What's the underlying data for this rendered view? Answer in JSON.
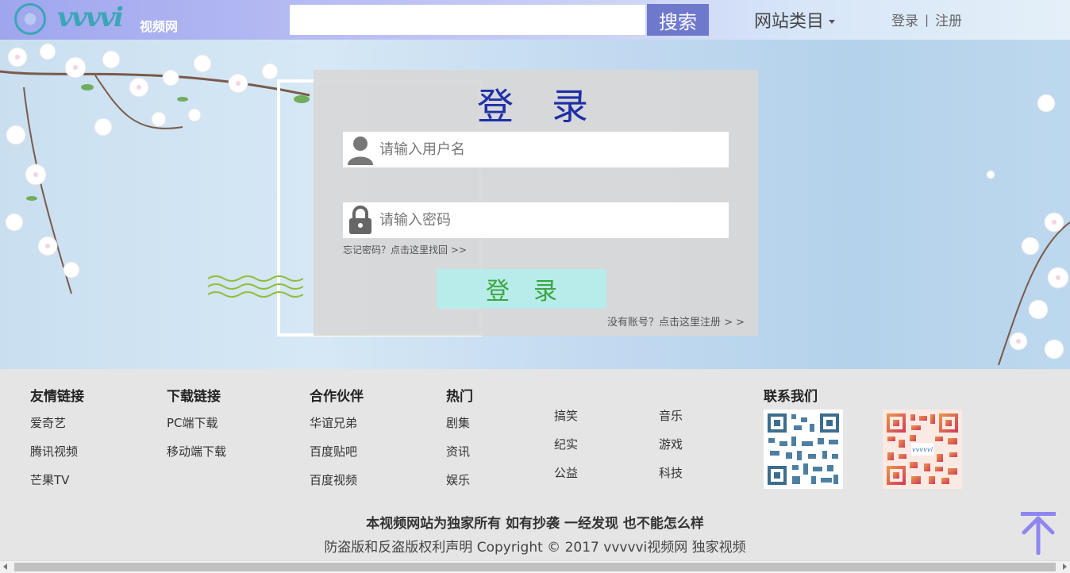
{
  "header": {
    "logo_text": "vvvvi",
    "logo_sub": "视频网",
    "search_placeholder": "",
    "search_button": "搜索",
    "category_label": "网站类目",
    "login_link": "登录",
    "separator": "|",
    "register_link": "注册"
  },
  "login": {
    "title": "登录",
    "username_placeholder": "请输入用户名",
    "password_placeholder": "请输入密码",
    "forgot": "忘记密码？点击这里找回 >>",
    "submit": "登录",
    "register": "没有账号？点击这里注册 > >"
  },
  "footer": {
    "friend_links": {
      "title": "友情链接",
      "items": [
        "爱奇艺",
        "腾讯视频",
        "芒果TV"
      ]
    },
    "downloads": {
      "title": "下载链接",
      "items": [
        "PC端下载",
        "移动端下载"
      ]
    },
    "partners": {
      "title": "合作伙伴",
      "items": [
        "华谊兄弟",
        "百度贴吧",
        "百度视频"
      ]
    },
    "hot": {
      "title": "热门",
      "items": [
        "剧集",
        "资讯",
        "娱乐"
      ]
    },
    "more_a": [
      "搞笑",
      "纪实",
      "公益"
    ],
    "more_b": [
      "音乐",
      "游戏",
      "科技"
    ],
    "contact": {
      "title": "联系我们"
    },
    "qr2_label": "vvvvvi",
    "copyright_1": "本视频网站为独家所有 如有抄袭 一经发现 也不能怎么样",
    "copyright_2": "防盗版和反盗版权利声明 Copyright © 2017 vvvvvi视频网 独家视频"
  },
  "colors": {
    "search_button": "#6f79cc",
    "login_title": "#1f2fa8",
    "login_button_bg": "#b7ecea",
    "login_button_text": "#3da640",
    "back_to_top": "#8f86f0"
  }
}
